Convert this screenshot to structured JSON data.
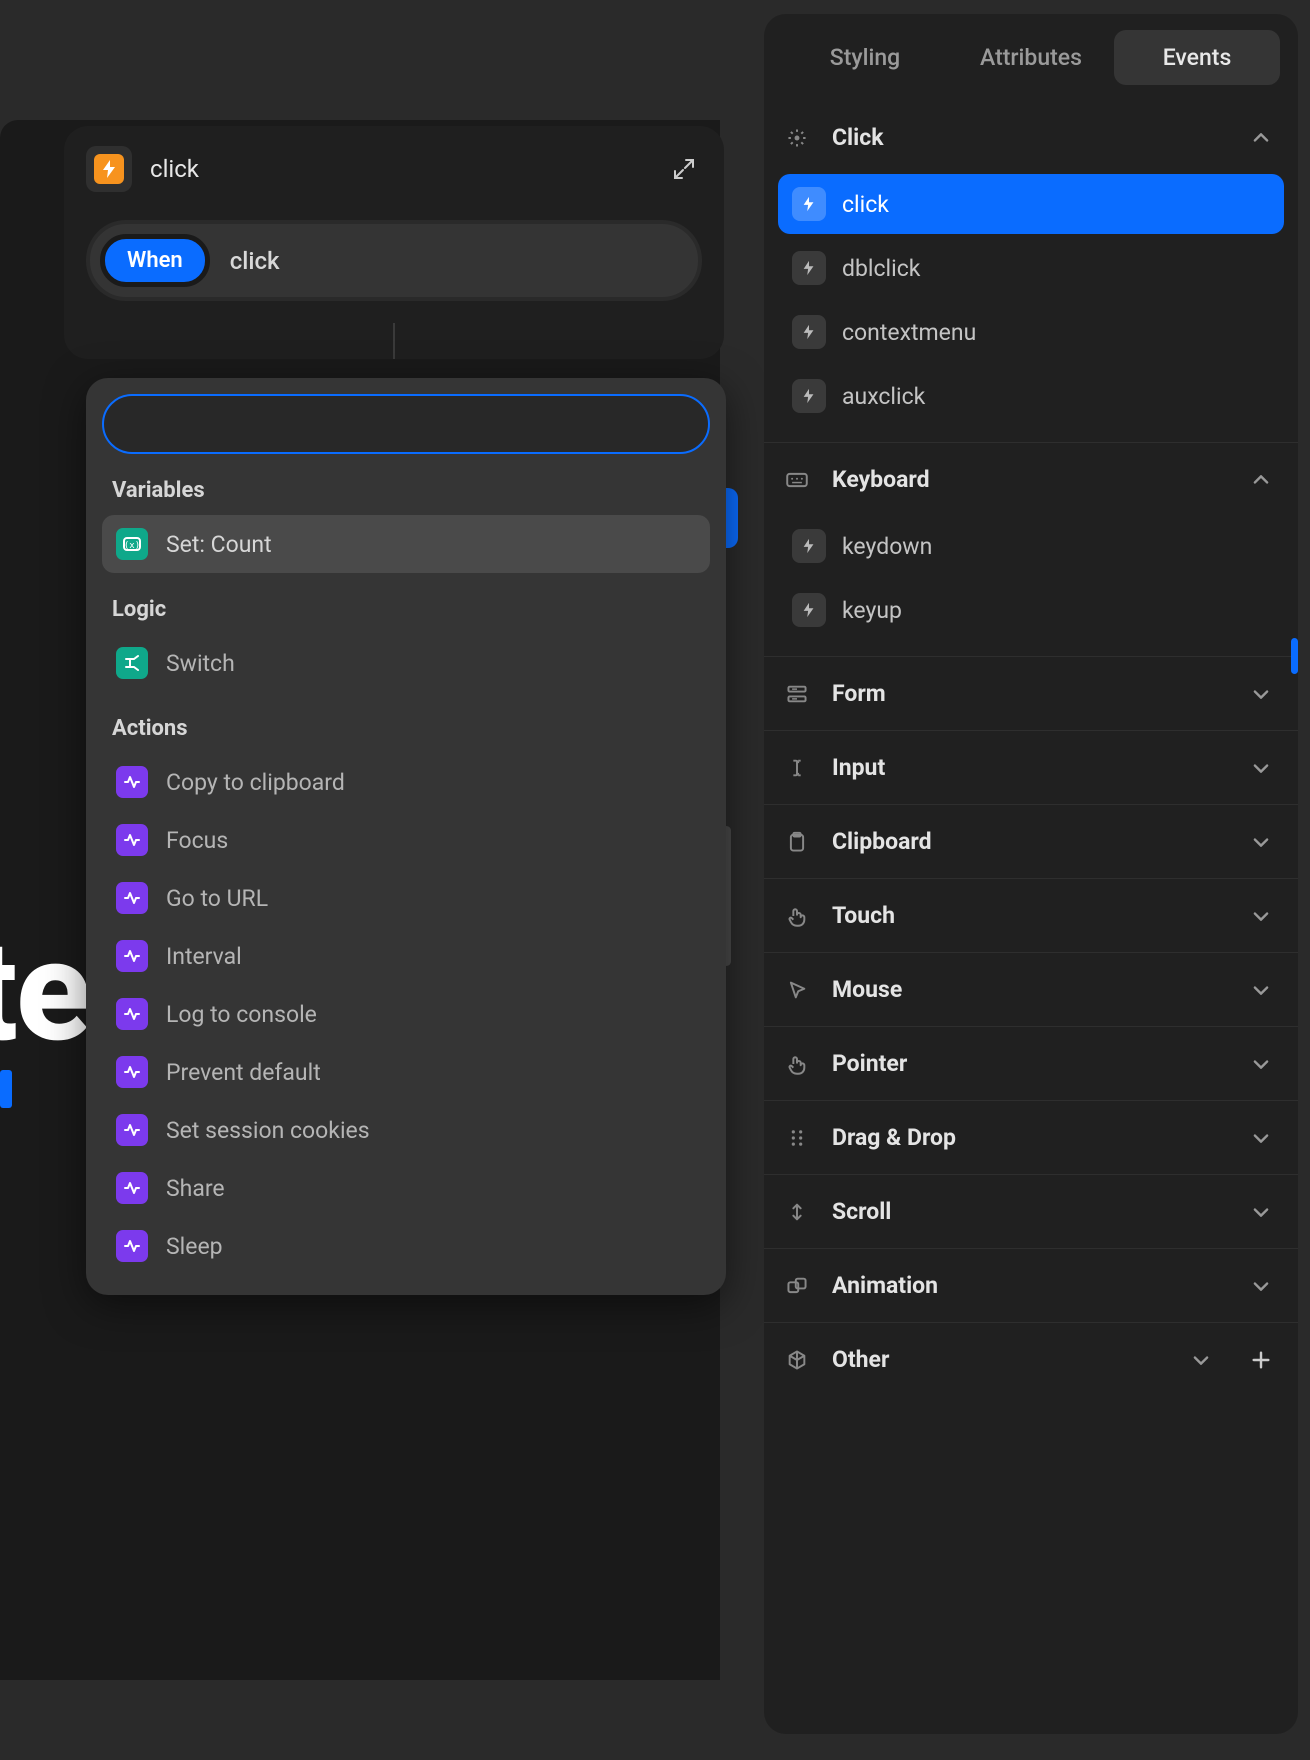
{
  "bg_word": "te",
  "flow": {
    "title": "click",
    "when_label": "When",
    "when_value": "click"
  },
  "search": {
    "placeholder": "",
    "groups": [
      {
        "label": "Variables",
        "items": [
          {
            "label": "Set: Count",
            "icon": "teal",
            "selected": true
          }
        ]
      },
      {
        "label": "Logic",
        "items": [
          {
            "label": "Switch",
            "icon": "teal",
            "selected": false
          }
        ]
      },
      {
        "label": "Actions",
        "items": [
          {
            "label": "Copy to clipboard",
            "icon": "purple",
            "selected": false
          },
          {
            "label": "Focus",
            "icon": "purple",
            "selected": false
          },
          {
            "label": "Go to URL",
            "icon": "purple",
            "selected": false
          },
          {
            "label": "Interval",
            "icon": "purple",
            "selected": false
          },
          {
            "label": "Log to console",
            "icon": "purple",
            "selected": false
          },
          {
            "label": "Prevent default",
            "icon": "purple",
            "selected": false
          },
          {
            "label": "Set session cookies",
            "icon": "purple",
            "selected": false
          },
          {
            "label": "Share",
            "icon": "purple",
            "selected": false
          },
          {
            "label": "Sleep",
            "icon": "purple",
            "selected": false
          }
        ]
      }
    ]
  },
  "sidebar": {
    "tabs": [
      {
        "label": "Styling",
        "active": false
      },
      {
        "label": "Attributes",
        "active": false
      },
      {
        "label": "Events",
        "active": true
      }
    ],
    "categories": [
      {
        "title": "Click",
        "icon": "cursor-click",
        "expanded": true,
        "events": [
          {
            "label": "click",
            "selected": true
          },
          {
            "label": "dblclick",
            "selected": false
          },
          {
            "label": "contextmenu",
            "selected": false
          },
          {
            "label": "auxclick",
            "selected": false
          }
        ]
      },
      {
        "title": "Keyboard",
        "icon": "keyboard",
        "expanded": true,
        "events": [
          {
            "label": "keydown",
            "selected": false
          },
          {
            "label": "keyup",
            "selected": false
          }
        ]
      },
      {
        "title": "Form",
        "icon": "form",
        "expanded": false,
        "events": []
      },
      {
        "title": "Input",
        "icon": "text-cursor",
        "expanded": false,
        "events": []
      },
      {
        "title": "Clipboard",
        "icon": "clipboard",
        "expanded": false,
        "events": []
      },
      {
        "title": "Touch",
        "icon": "hand",
        "expanded": false,
        "events": []
      },
      {
        "title": "Mouse",
        "icon": "mouse-pointer",
        "expanded": false,
        "events": []
      },
      {
        "title": "Pointer",
        "icon": "hand",
        "expanded": false,
        "events": []
      },
      {
        "title": "Drag & Drop",
        "icon": "drag",
        "expanded": false,
        "events": []
      },
      {
        "title": "Scroll",
        "icon": "scroll",
        "expanded": false,
        "events": []
      },
      {
        "title": "Animation",
        "icon": "animation",
        "expanded": false,
        "events": []
      },
      {
        "title": "Other",
        "icon": "cube",
        "expanded": false,
        "events": [],
        "has_add": true
      }
    ]
  }
}
